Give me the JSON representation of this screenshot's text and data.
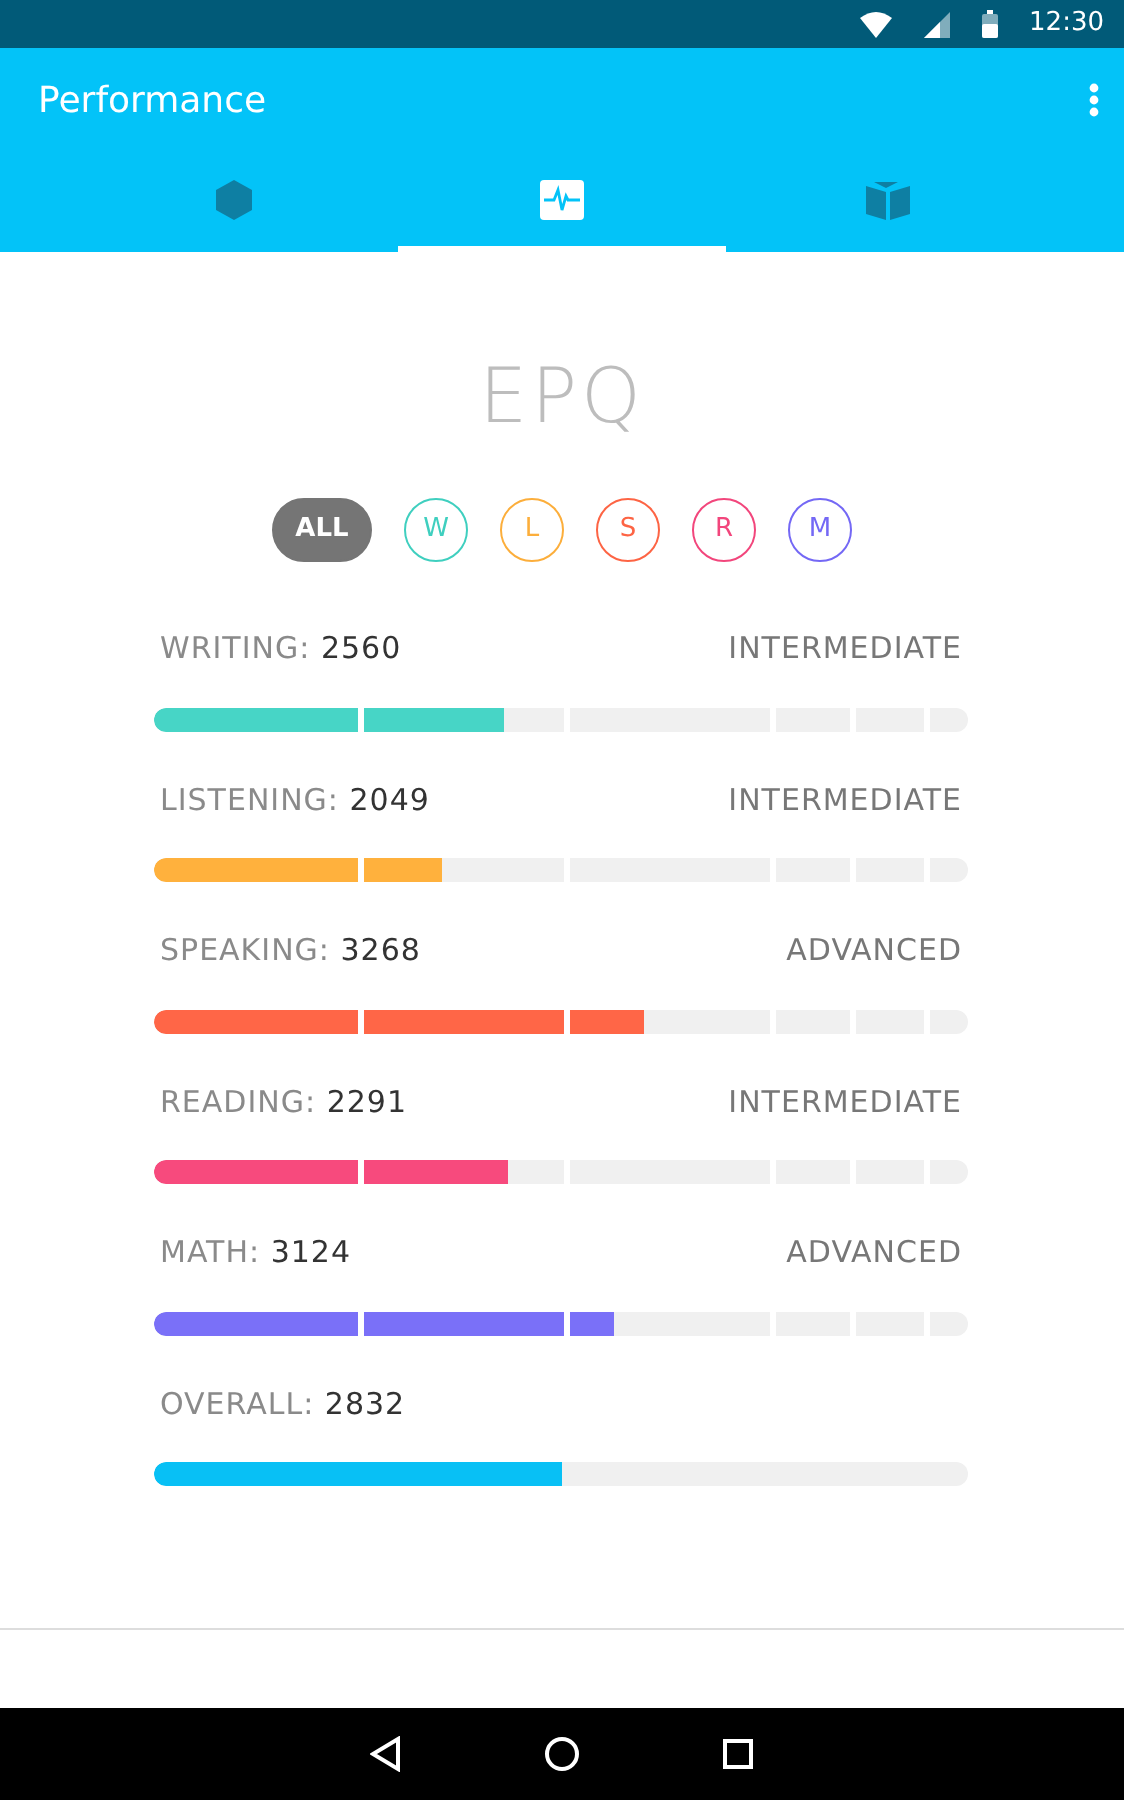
{
  "status_bar": {
    "time": "12:30"
  },
  "app_bar": {
    "title": "Performance"
  },
  "tabs": [
    {
      "kind": "hexagon",
      "selected": false
    },
    {
      "kind": "pulse",
      "selected": true
    },
    {
      "kind": "book",
      "selected": false
    }
  ],
  "heading": "EPQ",
  "filters": [
    {
      "label": "ALL",
      "selected": true,
      "color": "#757575"
    },
    {
      "label": "W",
      "selected": false,
      "color": "#3fcfbf"
    },
    {
      "label": "L",
      "selected": false,
      "color": "#fcae3b"
    },
    {
      "label": "S",
      "selected": false,
      "color": "#fd6444"
    },
    {
      "label": "R",
      "selected": false,
      "color": "#f2467c"
    },
    {
      "label": "M",
      "selected": false,
      "color": "#7468f5"
    }
  ],
  "scores": [
    {
      "kind": "segmented",
      "name": "WRITING:",
      "score": "2560",
      "band": "INTERMEDIATE",
      "level": 0.43,
      "color": "#47d5c6"
    },
    {
      "kind": "segmented",
      "name": "LISTENING:",
      "score": "2049",
      "band": "INTERMEDIATE",
      "level": 0.354,
      "color": "#ffb13d"
    },
    {
      "kind": "segmented",
      "name": "SPEAKING:",
      "score": "3268",
      "band": "ADVANCED",
      "level": 0.602,
      "color": "#ff6647"
    },
    {
      "kind": "segmented",
      "name": "READING:",
      "score": "2291",
      "band": "INTERMEDIATE",
      "level": 0.435,
      "color": "#f74a7d"
    },
    {
      "kind": "segmented",
      "name": "MATH:",
      "score": "3124",
      "band": "ADVANCED",
      "level": 0.565,
      "color": "#7a70f8"
    },
    {
      "kind": "plain",
      "name": "OVERALL:",
      "score": "2832",
      "level": 0.501,
      "color": "#08c0f5"
    }
  ]
}
